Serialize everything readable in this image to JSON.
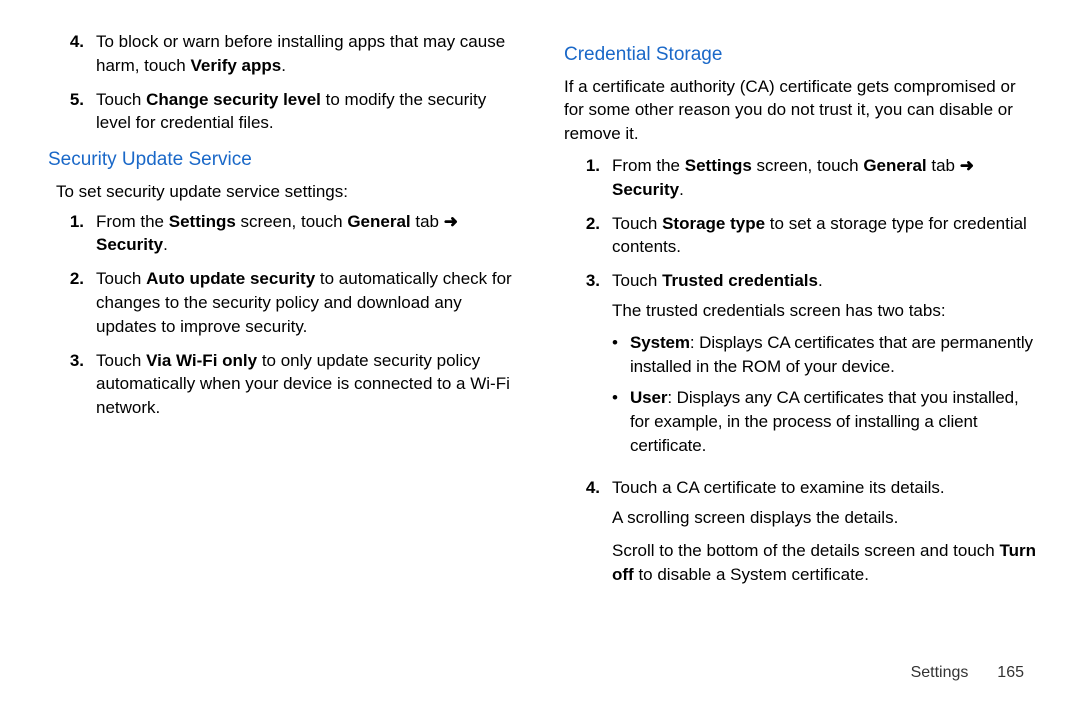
{
  "left": {
    "prelist": [
      {
        "num": "4.",
        "segments": [
          {
            "t": "To block or warn before installing apps that may cause harm, touch "
          },
          {
            "t": "Verify apps",
            "b": true
          },
          {
            "t": "."
          }
        ]
      },
      {
        "num": "5.",
        "segments": [
          {
            "t": "Touch "
          },
          {
            "t": "Change security level",
            "b": true
          },
          {
            "t": " to modify the security level for credential files."
          }
        ]
      }
    ],
    "heading": "Security Update Service",
    "intro": "To set security update service settings:",
    "list": [
      {
        "num": "1.",
        "segments": [
          {
            "t": "From the "
          },
          {
            "t": "Settings",
            "b": true
          },
          {
            "t": " screen, touch "
          },
          {
            "t": "General",
            "b": true
          },
          {
            "t": " tab "
          },
          {
            "arrow": true
          },
          {
            "t": " "
          },
          {
            "t": "Security",
            "b": true
          },
          {
            "t": "."
          }
        ]
      },
      {
        "num": "2.",
        "segments": [
          {
            "t": "Touch "
          },
          {
            "t": "Auto update security",
            "b": true
          },
          {
            "t": " to automatically check for changes to the security policy and download any updates to improve security."
          }
        ]
      },
      {
        "num": "3.",
        "segments": [
          {
            "t": "Touch "
          },
          {
            "t": "Via Wi-Fi only",
            "b": true
          },
          {
            "t": " to only update security policy automatically when your device is connected to a Wi-Fi network."
          }
        ]
      }
    ]
  },
  "right": {
    "heading": "Credential Storage",
    "intro": "If a certificate authority (CA) certificate gets compromised or for some other reason you do not trust it, you can disable or remove it.",
    "list": [
      {
        "num": "1.",
        "segments": [
          {
            "t": "From the "
          },
          {
            "t": "Settings",
            "b": true
          },
          {
            "t": " screen, touch "
          },
          {
            "t": "General",
            "b": true
          },
          {
            "t": " tab "
          },
          {
            "arrow": true
          },
          {
            "t": " "
          },
          {
            "t": "Security",
            "b": true
          },
          {
            "t": "."
          }
        ]
      },
      {
        "num": "2.",
        "segments": [
          {
            "t": "Touch "
          },
          {
            "t": "Storage type",
            "b": true
          },
          {
            "t": " to set a storage type for credential contents."
          }
        ]
      },
      {
        "num": "3.",
        "segments": [
          {
            "t": "Touch "
          },
          {
            "t": "Trusted credentials",
            "b": true
          },
          {
            "t": "."
          }
        ],
        "sub_plain": "The trusted credentials screen has two tabs:",
        "bullets": [
          {
            "lead": "System",
            "rest": ": Displays CA certificates that are permanently installed in the ROM of your device."
          },
          {
            "lead": "User",
            "rest": ": Displays any CA certificates that you installed, for example, in the process of installing a client certificate."
          }
        ]
      },
      {
        "num": "4.",
        "segments": [
          {
            "t": "Touch a CA certificate to examine its details."
          }
        ],
        "sub_plain": "A scrolling screen displays the details.",
        "sub2_segments": [
          {
            "t": "Scroll to the bottom of the details screen and touch "
          },
          {
            "t": "Turn off",
            "b": true
          },
          {
            "t": " to disable a System certificate."
          }
        ]
      }
    ]
  },
  "footer": {
    "section": "Settings",
    "page": "165"
  }
}
